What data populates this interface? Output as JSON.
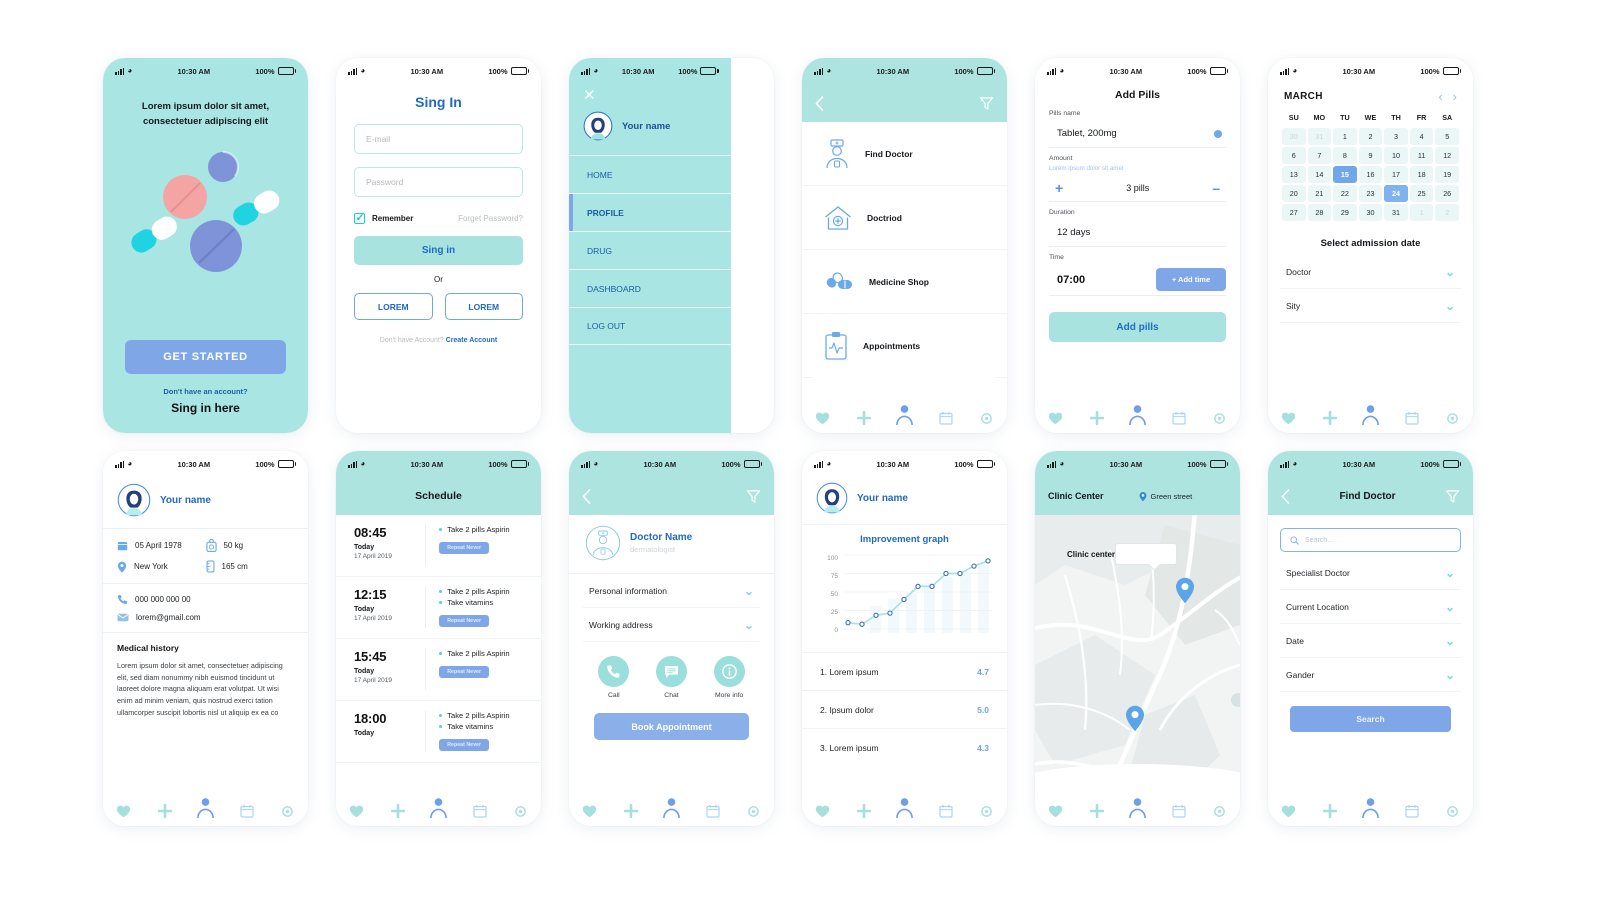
{
  "statusbar": {
    "time": "10:30 AM",
    "battery": "100%",
    "signal_icon": "signal-bars-icon",
    "wifi_icon": "wifi-icon",
    "battery_icon": "battery-icon"
  },
  "bottom_nav": [
    {
      "name": "heart-icon",
      "label": "Favorites"
    },
    {
      "name": "plus-icon",
      "label": "Add"
    },
    {
      "name": "person-icon",
      "label": "Profile"
    },
    {
      "name": "calendar-icon",
      "label": "Calendar"
    },
    {
      "name": "gear-icon",
      "label": "Settings"
    }
  ],
  "colors": {
    "teal": "#a9e6e3",
    "teal_header": "#ade4e0",
    "blue": "#7fa7e8",
    "blue_text": "#1f6bc4",
    "cyan": "#18cfd6",
    "mint_cell": "#eaf7f6"
  },
  "screen1_onboarding": {
    "tagline": "Lorem ipsum dolor sit amet, consectetuer adipiscing elit",
    "cta": "GET STARTED",
    "sub": "Don't have an account?",
    "sub2": "Sing in here"
  },
  "screen2_signin": {
    "title": "Sing In",
    "email_placeholder": "E-mail",
    "password_placeholder": "Password",
    "remember": "Remember",
    "forgot": "Forget Password?",
    "signin_button": "Sing in",
    "or": "Or",
    "social1": "LOREM",
    "social2": "LOREM",
    "footer_text": "Don't have Account?",
    "footer_link": "Create Account"
  },
  "screen3_menu": {
    "close_icon": "close-icon",
    "user_name": "Your name",
    "items": [
      {
        "label": "HOME",
        "active": false
      },
      {
        "label": "PROFILE",
        "active": true
      },
      {
        "label": "DRUG",
        "active": false
      },
      {
        "label": "DASHBOARD",
        "active": false
      },
      {
        "label": "LOG OUT",
        "active": false
      }
    ]
  },
  "screen4_categories": {
    "back_icon": "chevron-left-icon",
    "filter_icon": "filter-icon",
    "items": [
      {
        "label": "Find Doctor",
        "icon": "doctor-icon"
      },
      {
        "label": "Doctriod",
        "icon": "hospital-home-icon"
      },
      {
        "label": "Medicine Shop",
        "icon": "pills-icon"
      },
      {
        "label": "Appointments",
        "icon": "clipboard-pulse-icon"
      }
    ]
  },
  "screen5_addpills": {
    "title": "Add Pills",
    "pills_name_label": "Pills name",
    "pills_name_value": "Tablet, 200mg",
    "amount_label": "Amount",
    "amount_hint": "Lorem ipsum dolor sit amet",
    "amount_value": "3 pills",
    "plus": "+",
    "minus": "–",
    "duration_label": "Duration",
    "duration_value": "12 days",
    "time_label": "Time",
    "time_value": "07:00",
    "add_time_button": "+ Add time",
    "add_pills_button": "Add pills"
  },
  "screen6_calendar": {
    "month": "MARCH",
    "prev_icon": "chevron-left-icon",
    "next_icon": "chevron-right-icon",
    "weekdays": [
      "SU",
      "MO",
      "TU",
      "WE",
      "TH",
      "FR",
      "SA"
    ],
    "weeks": [
      [
        {
          "d": "30",
          "t": "mut"
        },
        {
          "d": "31",
          "t": "mut"
        },
        {
          "d": "1",
          "t": ""
        },
        {
          "d": "2",
          "t": ""
        },
        {
          "d": "3",
          "t": ""
        },
        {
          "d": "4",
          "t": ""
        },
        {
          "d": "5",
          "t": ""
        }
      ],
      [
        {
          "d": "6",
          "t": ""
        },
        {
          "d": "7",
          "t": ""
        },
        {
          "d": "8",
          "t": ""
        },
        {
          "d": "9",
          "t": ""
        },
        {
          "d": "10",
          "t": ""
        },
        {
          "d": "11",
          "t": ""
        },
        {
          "d": "12",
          "t": ""
        }
      ],
      [
        {
          "d": "13",
          "t": ""
        },
        {
          "d": "14",
          "t": ""
        },
        {
          "d": "15",
          "t": "sel"
        },
        {
          "d": "16",
          "t": ""
        },
        {
          "d": "17",
          "t": ""
        },
        {
          "d": "18",
          "t": ""
        },
        {
          "d": "19",
          "t": ""
        }
      ],
      [
        {
          "d": "20",
          "t": ""
        },
        {
          "d": "21",
          "t": ""
        },
        {
          "d": "22",
          "t": ""
        },
        {
          "d": "23",
          "t": ""
        },
        {
          "d": "24",
          "t": "sel2"
        },
        {
          "d": "25",
          "t": ""
        },
        {
          "d": "26",
          "t": ""
        }
      ],
      [
        {
          "d": "27",
          "t": ""
        },
        {
          "d": "28",
          "t": ""
        },
        {
          "d": "29",
          "t": ""
        },
        {
          "d": "30",
          "t": ""
        },
        {
          "d": "31",
          "t": ""
        },
        {
          "d": "1",
          "t": "mut"
        },
        {
          "d": "2",
          "t": "mut"
        }
      ]
    ],
    "subtitle": "Select admission date",
    "dropdowns": [
      "Doctor",
      "Sity"
    ]
  },
  "screen7_profile": {
    "user_name": "Your name",
    "birth_date": "05 April 1978",
    "city": "New York",
    "weight": "50 kg",
    "height": "165 cm",
    "phone": "000 000 000 00",
    "email": "lorem@gmail.com",
    "history_title": "Medical history",
    "history_body": "Lorem ipsum dolor sit amet, consectetuer adipiscing elit, sed diam nonummy nibh euismod tincidunt ut laoreet dolore magna aliquam erat volutpat. Ut wisi enim ad minim veniam, quis nostrud exerci tation ullamcorper suscipit lobortis nisl ut aliquip ex ea co"
  },
  "screen8_schedule": {
    "title": "Schedule",
    "events": [
      {
        "time": "08:45",
        "day": "Today",
        "date": "17 April 2019",
        "tasks": [
          "Take 2 pills Aspirin"
        ],
        "badge": "Repeat Never"
      },
      {
        "time": "12:15",
        "day": "Today",
        "date": "17 April 2019",
        "tasks": [
          "Take 2 pills Aspirin",
          "Take vitamins"
        ],
        "badge": "Repeat Never"
      },
      {
        "time": "15:45",
        "day": "Today",
        "date": "17 April 2019",
        "tasks": [
          "Take 2 pills Aspirin"
        ],
        "badge": "Repeat Never"
      },
      {
        "time": "18:00",
        "day": "Today",
        "date": "",
        "tasks": [
          "Take 2 pills Aspirin",
          "Take vitamins"
        ],
        "badge": "Repeat Never"
      }
    ]
  },
  "screen9_doctor": {
    "back_icon": "chevron-left-icon",
    "filter_icon": "filter-icon",
    "doctor_name": "Doctor Name",
    "specialty": "dermatologist",
    "sections": [
      "Personal information",
      "Working address"
    ],
    "actions": [
      {
        "label": "Call",
        "icon": "phone-icon"
      },
      {
        "label": "Chat",
        "icon": "chat-icon"
      },
      {
        "label": "More info",
        "icon": "info-icon"
      }
    ],
    "book_button": "Book Appointment"
  },
  "screen10_graph": {
    "user_name": "Your name",
    "items": [
      {
        "label": "1. Lorem ipsum",
        "value": "4.7"
      },
      {
        "label": "2. Ipsum dolor",
        "value": "5.0"
      },
      {
        "label": "3. Lorem ipsum",
        "value": "4.3"
      }
    ]
  },
  "chart_data": {
    "type": "line",
    "title": "Improvement graph",
    "xlabel": "",
    "ylabel": "",
    "ylim": [
      0,
      100
    ],
    "yticks": [
      0,
      25,
      50,
      75,
      100
    ],
    "grid": true,
    "legend": "none",
    "x": [
      1,
      2,
      3,
      4,
      5,
      6,
      7,
      8,
      9,
      10,
      11
    ],
    "values": [
      8,
      6,
      18,
      21,
      40,
      58,
      58,
      75,
      75,
      85,
      92
    ],
    "series": [
      {
        "name": "Improvement",
        "values": [
          8,
          6,
          18,
          21,
          40,
          58,
          58,
          75,
          75,
          85,
          92
        ]
      }
    ],
    "background_bars": [
      34,
      44,
      52,
      64,
      72,
      80,
      88
    ]
  },
  "screen11_map": {
    "title": "Clinic Center",
    "street": "Green street",
    "location_icon": "map-pin-icon",
    "callout_label": "Clinic center",
    "pins": [
      "map-pin-icon",
      "map-pin-icon"
    ]
  },
  "screen12_finddoctor": {
    "back_icon": "chevron-left-icon",
    "title": "Find Doctor",
    "filter_icon": "filter-icon",
    "search_placeholder": "Search...",
    "search_icon": "search-icon",
    "filters": [
      "Specialist Doctor",
      "Current Location",
      "Date",
      "Gander"
    ],
    "search_button": "Search"
  }
}
